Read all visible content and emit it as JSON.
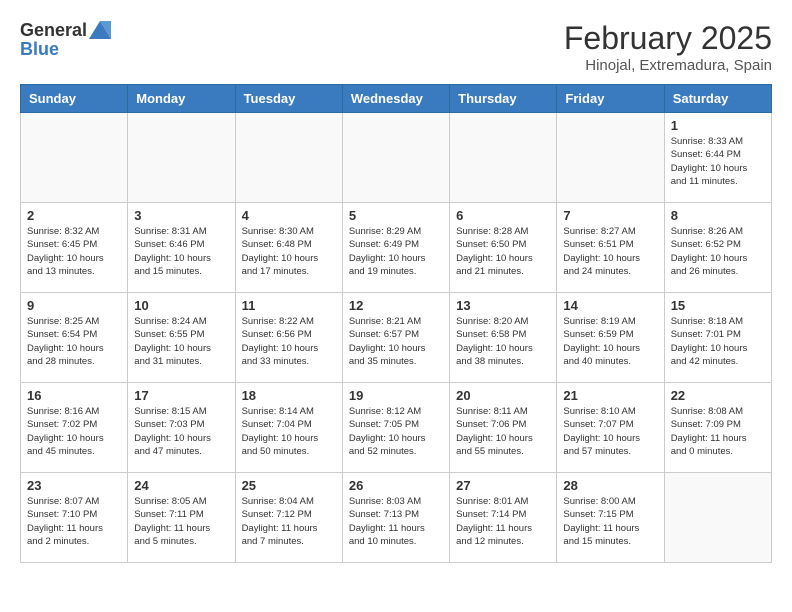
{
  "logo": {
    "general": "General",
    "blue": "Blue"
  },
  "title": "February 2025",
  "subtitle": "Hinojal, Extremadura, Spain",
  "headers": [
    "Sunday",
    "Monday",
    "Tuesday",
    "Wednesday",
    "Thursday",
    "Friday",
    "Saturday"
  ],
  "weeks": [
    [
      {
        "day": "",
        "info": ""
      },
      {
        "day": "",
        "info": ""
      },
      {
        "day": "",
        "info": ""
      },
      {
        "day": "",
        "info": ""
      },
      {
        "day": "",
        "info": ""
      },
      {
        "day": "",
        "info": ""
      },
      {
        "day": "1",
        "info": "Sunrise: 8:33 AM\nSunset: 6:44 PM\nDaylight: 10 hours and 11 minutes."
      }
    ],
    [
      {
        "day": "2",
        "info": "Sunrise: 8:32 AM\nSunset: 6:45 PM\nDaylight: 10 hours and 13 minutes."
      },
      {
        "day": "3",
        "info": "Sunrise: 8:31 AM\nSunset: 6:46 PM\nDaylight: 10 hours and 15 minutes."
      },
      {
        "day": "4",
        "info": "Sunrise: 8:30 AM\nSunset: 6:48 PM\nDaylight: 10 hours and 17 minutes."
      },
      {
        "day": "5",
        "info": "Sunrise: 8:29 AM\nSunset: 6:49 PM\nDaylight: 10 hours and 19 minutes."
      },
      {
        "day": "6",
        "info": "Sunrise: 8:28 AM\nSunset: 6:50 PM\nDaylight: 10 hours and 21 minutes."
      },
      {
        "day": "7",
        "info": "Sunrise: 8:27 AM\nSunset: 6:51 PM\nDaylight: 10 hours and 24 minutes."
      },
      {
        "day": "8",
        "info": "Sunrise: 8:26 AM\nSunset: 6:52 PM\nDaylight: 10 hours and 26 minutes."
      }
    ],
    [
      {
        "day": "9",
        "info": "Sunrise: 8:25 AM\nSunset: 6:54 PM\nDaylight: 10 hours and 28 minutes."
      },
      {
        "day": "10",
        "info": "Sunrise: 8:24 AM\nSunset: 6:55 PM\nDaylight: 10 hours and 31 minutes."
      },
      {
        "day": "11",
        "info": "Sunrise: 8:22 AM\nSunset: 6:56 PM\nDaylight: 10 hours and 33 minutes."
      },
      {
        "day": "12",
        "info": "Sunrise: 8:21 AM\nSunset: 6:57 PM\nDaylight: 10 hours and 35 minutes."
      },
      {
        "day": "13",
        "info": "Sunrise: 8:20 AM\nSunset: 6:58 PM\nDaylight: 10 hours and 38 minutes."
      },
      {
        "day": "14",
        "info": "Sunrise: 8:19 AM\nSunset: 6:59 PM\nDaylight: 10 hours and 40 minutes."
      },
      {
        "day": "15",
        "info": "Sunrise: 8:18 AM\nSunset: 7:01 PM\nDaylight: 10 hours and 42 minutes."
      }
    ],
    [
      {
        "day": "16",
        "info": "Sunrise: 8:16 AM\nSunset: 7:02 PM\nDaylight: 10 hours and 45 minutes."
      },
      {
        "day": "17",
        "info": "Sunrise: 8:15 AM\nSunset: 7:03 PM\nDaylight: 10 hours and 47 minutes."
      },
      {
        "day": "18",
        "info": "Sunrise: 8:14 AM\nSunset: 7:04 PM\nDaylight: 10 hours and 50 minutes."
      },
      {
        "day": "19",
        "info": "Sunrise: 8:12 AM\nSunset: 7:05 PM\nDaylight: 10 hours and 52 minutes."
      },
      {
        "day": "20",
        "info": "Sunrise: 8:11 AM\nSunset: 7:06 PM\nDaylight: 10 hours and 55 minutes."
      },
      {
        "day": "21",
        "info": "Sunrise: 8:10 AM\nSunset: 7:07 PM\nDaylight: 10 hours and 57 minutes."
      },
      {
        "day": "22",
        "info": "Sunrise: 8:08 AM\nSunset: 7:09 PM\nDaylight: 11 hours and 0 minutes."
      }
    ],
    [
      {
        "day": "23",
        "info": "Sunrise: 8:07 AM\nSunset: 7:10 PM\nDaylight: 11 hours and 2 minutes."
      },
      {
        "day": "24",
        "info": "Sunrise: 8:05 AM\nSunset: 7:11 PM\nDaylight: 11 hours and 5 minutes."
      },
      {
        "day": "25",
        "info": "Sunrise: 8:04 AM\nSunset: 7:12 PM\nDaylight: 11 hours and 7 minutes."
      },
      {
        "day": "26",
        "info": "Sunrise: 8:03 AM\nSunset: 7:13 PM\nDaylight: 11 hours and 10 minutes."
      },
      {
        "day": "27",
        "info": "Sunrise: 8:01 AM\nSunset: 7:14 PM\nDaylight: 11 hours and 12 minutes."
      },
      {
        "day": "28",
        "info": "Sunrise: 8:00 AM\nSunset: 7:15 PM\nDaylight: 11 hours and 15 minutes."
      },
      {
        "day": "",
        "info": ""
      }
    ]
  ]
}
